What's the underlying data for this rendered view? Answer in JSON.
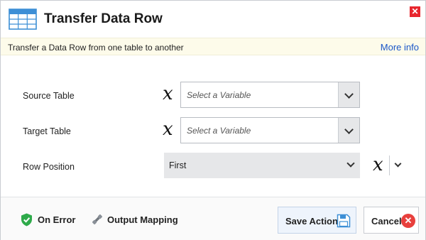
{
  "header": {
    "title": "Transfer Data Row",
    "icon": "table-icon",
    "close_icon": "close-icon"
  },
  "infobar": {
    "description": "Transfer a Data Row from one table to another",
    "more_info": "More info"
  },
  "form": {
    "source": {
      "label": "Source Table",
      "variable_icon": "x",
      "placeholder": "Select a Variable"
    },
    "target": {
      "label": "Target Table",
      "variable_icon": "x",
      "placeholder": "Select a Variable"
    },
    "position": {
      "label": "Row Position",
      "value": "First",
      "variable_icon": "x"
    }
  },
  "footer": {
    "on_error": "On Error",
    "output_mapping": "Output Mapping",
    "save": "Save Action",
    "cancel": "Cancel"
  },
  "colors": {
    "accent_blue": "#1a56c8",
    "close_red": "#e8262e",
    "info_bg": "#fdfbea",
    "shield_green": "#2eaa4a"
  }
}
